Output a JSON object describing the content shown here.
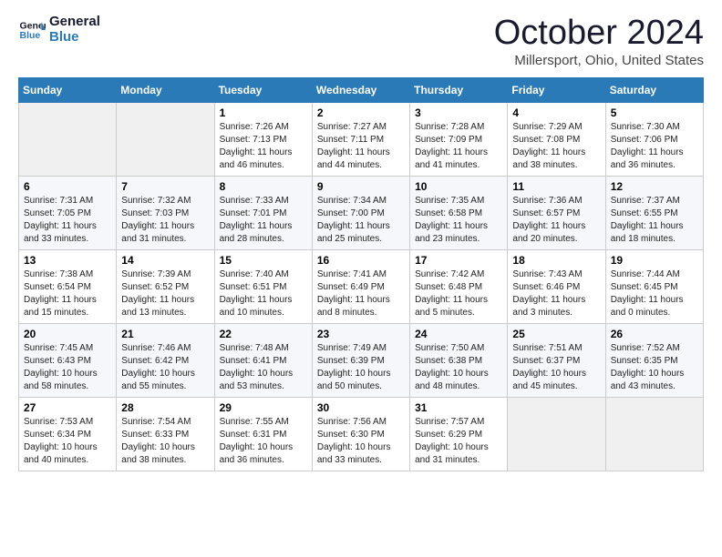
{
  "logo": {
    "line1": "General",
    "line2": "Blue"
  },
  "title": "October 2024",
  "location": "Millersport, Ohio, United States",
  "weekdays": [
    "Sunday",
    "Monday",
    "Tuesday",
    "Wednesday",
    "Thursday",
    "Friday",
    "Saturday"
  ],
  "weeks": [
    [
      {
        "day": "",
        "info": ""
      },
      {
        "day": "",
        "info": ""
      },
      {
        "day": "1",
        "info": "Sunrise: 7:26 AM\nSunset: 7:13 PM\nDaylight: 11 hours and 46 minutes."
      },
      {
        "day": "2",
        "info": "Sunrise: 7:27 AM\nSunset: 7:11 PM\nDaylight: 11 hours and 44 minutes."
      },
      {
        "day": "3",
        "info": "Sunrise: 7:28 AM\nSunset: 7:09 PM\nDaylight: 11 hours and 41 minutes."
      },
      {
        "day": "4",
        "info": "Sunrise: 7:29 AM\nSunset: 7:08 PM\nDaylight: 11 hours and 38 minutes."
      },
      {
        "day": "5",
        "info": "Sunrise: 7:30 AM\nSunset: 7:06 PM\nDaylight: 11 hours and 36 minutes."
      }
    ],
    [
      {
        "day": "6",
        "info": "Sunrise: 7:31 AM\nSunset: 7:05 PM\nDaylight: 11 hours and 33 minutes."
      },
      {
        "day": "7",
        "info": "Sunrise: 7:32 AM\nSunset: 7:03 PM\nDaylight: 11 hours and 31 minutes."
      },
      {
        "day": "8",
        "info": "Sunrise: 7:33 AM\nSunset: 7:01 PM\nDaylight: 11 hours and 28 minutes."
      },
      {
        "day": "9",
        "info": "Sunrise: 7:34 AM\nSunset: 7:00 PM\nDaylight: 11 hours and 25 minutes."
      },
      {
        "day": "10",
        "info": "Sunrise: 7:35 AM\nSunset: 6:58 PM\nDaylight: 11 hours and 23 minutes."
      },
      {
        "day": "11",
        "info": "Sunrise: 7:36 AM\nSunset: 6:57 PM\nDaylight: 11 hours and 20 minutes."
      },
      {
        "day": "12",
        "info": "Sunrise: 7:37 AM\nSunset: 6:55 PM\nDaylight: 11 hours and 18 minutes."
      }
    ],
    [
      {
        "day": "13",
        "info": "Sunrise: 7:38 AM\nSunset: 6:54 PM\nDaylight: 11 hours and 15 minutes."
      },
      {
        "day": "14",
        "info": "Sunrise: 7:39 AM\nSunset: 6:52 PM\nDaylight: 11 hours and 13 minutes."
      },
      {
        "day": "15",
        "info": "Sunrise: 7:40 AM\nSunset: 6:51 PM\nDaylight: 11 hours and 10 minutes."
      },
      {
        "day": "16",
        "info": "Sunrise: 7:41 AM\nSunset: 6:49 PM\nDaylight: 11 hours and 8 minutes."
      },
      {
        "day": "17",
        "info": "Sunrise: 7:42 AM\nSunset: 6:48 PM\nDaylight: 11 hours and 5 minutes."
      },
      {
        "day": "18",
        "info": "Sunrise: 7:43 AM\nSunset: 6:46 PM\nDaylight: 11 hours and 3 minutes."
      },
      {
        "day": "19",
        "info": "Sunrise: 7:44 AM\nSunset: 6:45 PM\nDaylight: 11 hours and 0 minutes."
      }
    ],
    [
      {
        "day": "20",
        "info": "Sunrise: 7:45 AM\nSunset: 6:43 PM\nDaylight: 10 hours and 58 minutes."
      },
      {
        "day": "21",
        "info": "Sunrise: 7:46 AM\nSunset: 6:42 PM\nDaylight: 10 hours and 55 minutes."
      },
      {
        "day": "22",
        "info": "Sunrise: 7:48 AM\nSunset: 6:41 PM\nDaylight: 10 hours and 53 minutes."
      },
      {
        "day": "23",
        "info": "Sunrise: 7:49 AM\nSunset: 6:39 PM\nDaylight: 10 hours and 50 minutes."
      },
      {
        "day": "24",
        "info": "Sunrise: 7:50 AM\nSunset: 6:38 PM\nDaylight: 10 hours and 48 minutes."
      },
      {
        "day": "25",
        "info": "Sunrise: 7:51 AM\nSunset: 6:37 PM\nDaylight: 10 hours and 45 minutes."
      },
      {
        "day": "26",
        "info": "Sunrise: 7:52 AM\nSunset: 6:35 PM\nDaylight: 10 hours and 43 minutes."
      }
    ],
    [
      {
        "day": "27",
        "info": "Sunrise: 7:53 AM\nSunset: 6:34 PM\nDaylight: 10 hours and 40 minutes."
      },
      {
        "day": "28",
        "info": "Sunrise: 7:54 AM\nSunset: 6:33 PM\nDaylight: 10 hours and 38 minutes."
      },
      {
        "day": "29",
        "info": "Sunrise: 7:55 AM\nSunset: 6:31 PM\nDaylight: 10 hours and 36 minutes."
      },
      {
        "day": "30",
        "info": "Sunrise: 7:56 AM\nSunset: 6:30 PM\nDaylight: 10 hours and 33 minutes."
      },
      {
        "day": "31",
        "info": "Sunrise: 7:57 AM\nSunset: 6:29 PM\nDaylight: 10 hours and 31 minutes."
      },
      {
        "day": "",
        "info": ""
      },
      {
        "day": "",
        "info": ""
      }
    ]
  ]
}
